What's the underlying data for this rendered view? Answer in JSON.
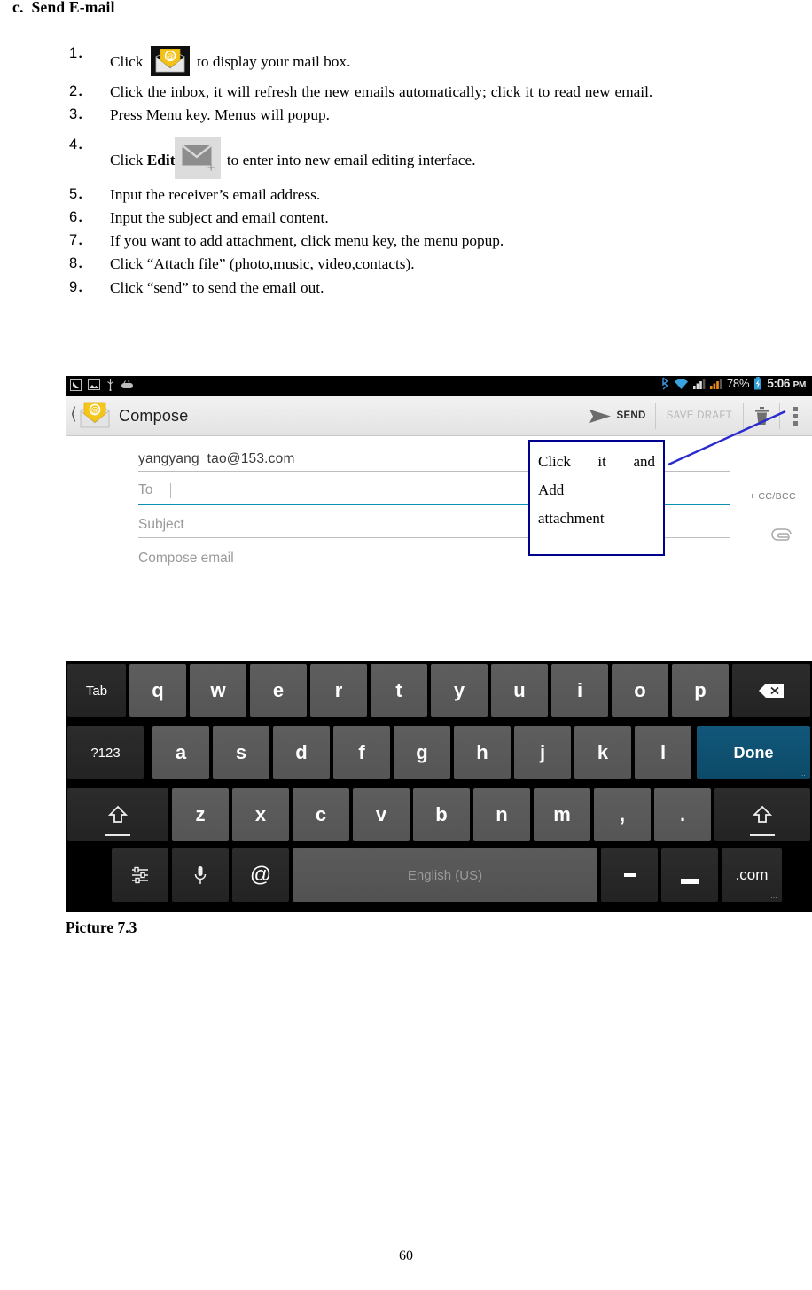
{
  "document": {
    "section_letter": "c.",
    "section_title": "Send E-mail",
    "steps": [
      {
        "num": "1",
        "text_before": "Click",
        "icon": "mail-at-icon",
        "text_after": "to display your mail box."
      },
      {
        "num": "2",
        "text": "Click the inbox, it will refresh the new emails automatically; click it to read new email."
      },
      {
        "num": "3",
        "text": "Press Menu key. Menus will popup."
      },
      {
        "num": "4",
        "text_before": "Click",
        "bold": "Edit",
        "icon": "new-mail-plus-icon",
        "text_after": "to enter into new email editing interface."
      },
      {
        "num": "5",
        "text": "Input the receiver’s email address."
      },
      {
        "num": "6",
        "text": "Input the subject and email content."
      },
      {
        "num": "7",
        "text": "If you want to add attachment, click menu key, the menu popup."
      },
      {
        "num": "8",
        "text": "Click “Attach file” (photo,music, video,contacts)."
      },
      {
        "num": "9",
        "text": "Click “send” to send the email out."
      }
    ],
    "caption": "Picture 7.3",
    "page_number": "60"
  },
  "screenshot": {
    "statusbar": {
      "left_icons": [
        "screenshot-icon",
        "image-icon",
        "usb-icon",
        "adb-icon"
      ],
      "right_icons": [
        "bluetooth-icon",
        "wifi-icon",
        "signal-icon-1",
        "signal-icon-2",
        "battery-charging-icon"
      ],
      "battery_percent": "78%",
      "time": "5:06",
      "meridiem": "PM"
    },
    "actionbar": {
      "back_icon": "back-chevron-icon",
      "app_icon": "mail-at-icon",
      "title": "Compose",
      "send_label": "SEND",
      "send_icon": "send-plane-icon",
      "save_draft_label": "SAVE DRAFT",
      "delete_icon": "trash-icon",
      "overflow_icon": "overflow-menu-icon"
    },
    "compose": {
      "from_value": "yangyang_tao@153.com",
      "to_placeholder": "To",
      "to_value": "",
      "subject_placeholder": "Subject",
      "subject_value": "",
      "body_placeholder": "Compose email",
      "body_value": "",
      "cc_bcc_label": "+ CC/BCC",
      "attach_icon": "paperclip-icon"
    },
    "annotation": {
      "line1_a": "Click",
      "line1_b": "it",
      "line1_c": "and",
      "line2": "Add",
      "line3": "attachment",
      "border_color": "#00008f",
      "arrow_color": "#2a2ad0"
    },
    "keyboard": {
      "accent_done_color": "#0d4a68",
      "rows": [
        {
          "keys": [
            {
              "label": "Tab",
              "type": "func",
              "name": "key-tab"
            },
            {
              "label": "q",
              "type": "letter",
              "name": "key-q"
            },
            {
              "label": "w",
              "type": "letter",
              "name": "key-w"
            },
            {
              "label": "e",
              "type": "letter",
              "name": "key-e"
            },
            {
              "label": "r",
              "type": "letter",
              "name": "key-r"
            },
            {
              "label": "t",
              "type": "letter",
              "name": "key-t"
            },
            {
              "label": "y",
              "type": "letter",
              "name": "key-y"
            },
            {
              "label": "u",
              "type": "letter",
              "name": "key-u"
            },
            {
              "label": "i",
              "type": "letter",
              "name": "key-i"
            },
            {
              "label": "o",
              "type": "letter",
              "name": "key-o"
            },
            {
              "label": "p",
              "type": "letter",
              "name": "key-p"
            },
            {
              "label": "",
              "type": "func",
              "name": "key-backspace",
              "icon": "backspace-icon"
            }
          ]
        },
        {
          "keys": [
            {
              "label": "?123",
              "type": "func",
              "name": "key-symbols"
            },
            {
              "label": "a",
              "type": "letter",
              "name": "key-a"
            },
            {
              "label": "s",
              "type": "letter",
              "name": "key-s"
            },
            {
              "label": "d",
              "type": "letter",
              "name": "key-d"
            },
            {
              "label": "f",
              "type": "letter",
              "name": "key-f"
            },
            {
              "label": "g",
              "type": "letter",
              "name": "key-g"
            },
            {
              "label": "h",
              "type": "letter",
              "name": "key-h"
            },
            {
              "label": "j",
              "type": "letter",
              "name": "key-j"
            },
            {
              "label": "k",
              "type": "letter",
              "name": "key-k"
            },
            {
              "label": "l",
              "type": "letter",
              "name": "key-l"
            },
            {
              "label": "Done",
              "type": "done",
              "name": "key-done",
              "sub": "..."
            }
          ]
        },
        {
          "keys": [
            {
              "label": "",
              "type": "func",
              "name": "key-shift-left",
              "icon": "shift-icon"
            },
            {
              "label": "z",
              "type": "letter",
              "name": "key-z"
            },
            {
              "label": "x",
              "type": "letter",
              "name": "key-x"
            },
            {
              "label": "c",
              "type": "letter",
              "name": "key-c"
            },
            {
              "label": "v",
              "type": "letter",
              "name": "key-v"
            },
            {
              "label": "b",
              "type": "letter",
              "name": "key-b"
            },
            {
              "label": "n",
              "type": "letter",
              "name": "key-n"
            },
            {
              "label": "m",
              "type": "letter",
              "name": "key-m"
            },
            {
              "label": ",",
              "type": "letter",
              "name": "key-comma"
            },
            {
              "label": ".",
              "type": "letter",
              "name": "key-period"
            },
            {
              "label": "",
              "type": "func",
              "name": "key-shift-right",
              "icon": "shift-icon"
            }
          ]
        },
        {
          "keys": [
            {
              "label": "",
              "type": "func",
              "name": "key-settings",
              "icon": "keyboard-settings-icon"
            },
            {
              "label": "",
              "type": "func",
              "name": "key-voice",
              "icon": "microphone-icon"
            },
            {
              "label": "@",
              "type": "func",
              "name": "key-at"
            },
            {
              "label": "English (US)",
              "type": "space",
              "name": "key-space"
            },
            {
              "label": "-",
              "type": "func",
              "name": "key-hyphen"
            },
            {
              "label": "_",
              "type": "func",
              "name": "key-underscore"
            },
            {
              "label": ".com",
              "type": "func",
              "name": "key-dotcom",
              "sub": "..."
            }
          ]
        }
      ]
    }
  }
}
